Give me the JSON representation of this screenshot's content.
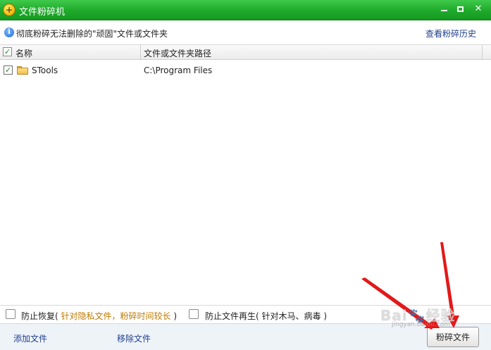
{
  "window": {
    "title": "文件粉碎机",
    "app_icon": "plus-shield-icon",
    "controls": [
      "minimize-icon",
      "maximize-icon",
      "close-icon"
    ],
    "accent": "#1fa92b"
  },
  "infobar": {
    "icon": "info-icon",
    "text": "彻底粉碎无法删除的\"顽固\"文件或文件夹",
    "history_link": "查看粉碎历史"
  },
  "list": {
    "columns": [
      "名称",
      "文件或文件夹路径"
    ],
    "header_checked": true,
    "rows": [
      {
        "checked": true,
        "icon": "folder-icon",
        "name": "STools",
        "path": "C:\\Program Files"
      }
    ]
  },
  "options": {
    "prevent_recovery": {
      "label": "防止恢复",
      "hint": "针对隐私文件，粉碎时间较长",
      "checked": false
    },
    "prevent_regen": {
      "label": "防止文件再生",
      "hint": "针对木马、病毒",
      "checked": false
    }
  },
  "footer": {
    "add_file": "添加文件",
    "remove_file": "移除文件",
    "shred_button": "粉碎文件"
  },
  "watermark": {
    "brand": "Bai",
    "suffix": "经验",
    "url": "jingyan.baidu.com"
  }
}
